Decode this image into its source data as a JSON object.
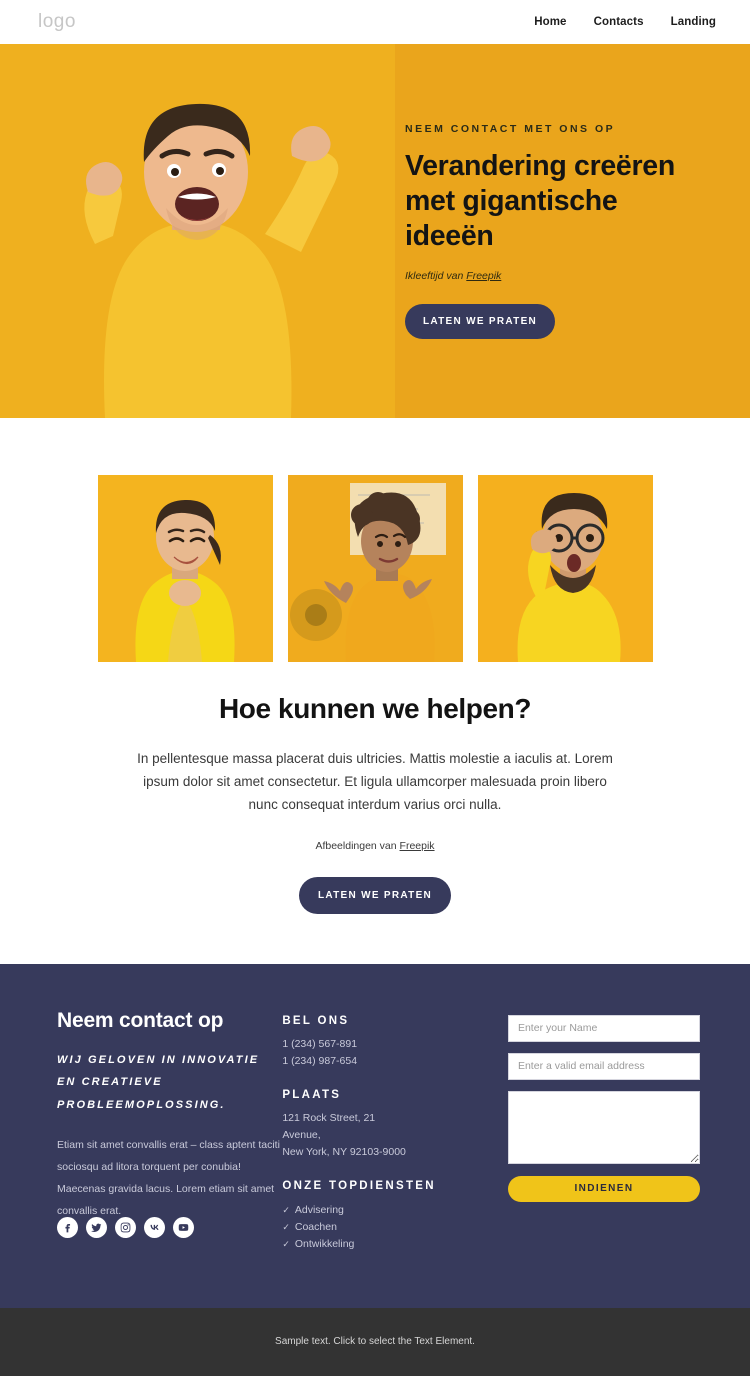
{
  "header": {
    "logo": "logo",
    "nav": [
      {
        "label": "Home"
      },
      {
        "label": "Contacts"
      },
      {
        "label": "Landing"
      }
    ]
  },
  "hero": {
    "eyebrow": "NEEM CONTACT MET ONS OP",
    "title": "Verandering creëren met gigantische ideeën",
    "credit_prefix": "Ikleeftijd van ",
    "credit_link": "Freepik",
    "cta_label": "LATEN WE PRATEN",
    "bg_color": "#eaa51c",
    "cta_color": "#373a5c"
  },
  "cards": [
    {
      "alt": "smiling-woman-yellow-tshirt"
    },
    {
      "alt": "woman-shrugging-yellow-shirt"
    },
    {
      "alt": "surprised-man-glasses-yellow-tshirt"
    }
  ],
  "help": {
    "title": "Hoe kunnen we helpen?",
    "paragraph": "In pellentesque massa placerat duis ultricies. Mattis molestie a iaculis at. Lorem ipsum dolor sit amet consectetur. Et ligula ullamcorper malesuada proin libero nunc consequat interdum varius orci nulla.",
    "credit_prefix": "Afbeeldingen van ",
    "credit_link": "Freepik",
    "cta_label": "LATEN WE PRATEN"
  },
  "footer": {
    "bg_color": "#373a5c",
    "heading": "Neem contact op",
    "tagline": "WIJ GELOVEN IN INNOVATIE EN CREATIEVE PROBLEEMOPLOSSING.",
    "body": "Etiam sit amet convallis erat – class aptent taciti sociosqu ad litora torquent per conubia! Maecenas gravida lacus. Lorem etiam sit amet convallis erat.",
    "socials": [
      {
        "name": "facebook"
      },
      {
        "name": "twitter"
      },
      {
        "name": "instagram"
      },
      {
        "name": "vk"
      },
      {
        "name": "youtube"
      }
    ],
    "call_title": "BEL ONS",
    "phone_1": "1 (234) 567-891",
    "phone_2": "1 (234) 987-654",
    "place_title": "PLAATS",
    "address_1": "121 Rock Street, 21",
    "address_2": "Avenue,",
    "address_3": "New York, NY 92103-9000",
    "services_title": "ONZE TOPDIENSTEN",
    "services": [
      {
        "label": "Advisering"
      },
      {
        "label": "Coachen"
      },
      {
        "label": "Ontwikkeling"
      }
    ],
    "form": {
      "name_placeholder": "Enter your Name",
      "name_value": "",
      "email_placeholder": "Enter a valid email address",
      "email_value": "",
      "message_placeholder": "",
      "message_value": "",
      "submit_label": "INDIENEN",
      "submit_color": "#f0c419"
    }
  },
  "bottombar": {
    "text": "Sample text. Click to select the Text Element."
  }
}
